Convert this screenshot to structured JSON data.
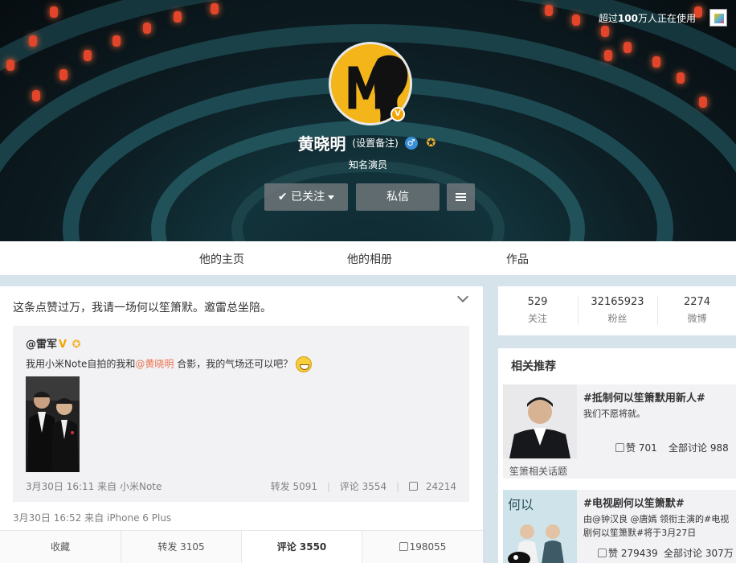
{
  "cover": {
    "top_note_prefix": "超过",
    "top_note_bold": "100",
    "top_note_suffix": "万人正在使用"
  },
  "profile": {
    "name": "黄晓明",
    "remark": "(设置备注)",
    "gender_symbol": "♂",
    "verify_badge": "V",
    "verification": "知名演员",
    "follow_label": "已关注",
    "message_label": "私信"
  },
  "tabs": [
    "他的主页",
    "他的相册",
    "作品"
  ],
  "post": {
    "text": "这条点赞过万，我请一场何以笙箫默。邀雷总坐陪。",
    "repost": {
      "user": "@雷军",
      "v": "V",
      "text_before": "我用小米Note自拍的我和",
      "mention": "@黄晓明",
      "text_after": " 合影，我的气场还可以吧？",
      "time": "3月30日 16:11",
      "source_prefix": "来自",
      "source": "小米Note",
      "repost_count": "转发 5091",
      "comment_count": "评论 3554",
      "like_count": "24214"
    },
    "time": "3月30日 16:52",
    "source_prefix": "来自",
    "source": "iPhone 6 Plus",
    "actions": {
      "collect": "收藏",
      "repost": "转发 3105",
      "comment": "评论 3550",
      "like": "198055"
    }
  },
  "counts": [
    {
      "num": "529",
      "label": "关注"
    },
    {
      "num": "32165923",
      "label": "粉丝"
    },
    {
      "num": "2274",
      "label": "微博"
    }
  ],
  "recommend": {
    "title": "相关推荐",
    "items": [
      {
        "topic": "#抵制何以笙箫默用新人#",
        "desc": "我们不愿将就。",
        "likes": "赞 701",
        "discuss": "全部讨论 988",
        "footer": "笙箫相关话题"
      },
      {
        "topic": "#电视剧何以笙箫默#",
        "desc": "由@钟汉良 @唐嫣 领衔主演的#电视剧何以笙箫默#将于3月27日",
        "likes": "赞 279439",
        "discuss": "全部讨论 307万"
      }
    ]
  },
  "colors": {
    "mention": "#eb7350",
    "verified": "#f4a300",
    "avatar_bg": "#f3b51a",
    "gender": "#3a8fd8"
  }
}
